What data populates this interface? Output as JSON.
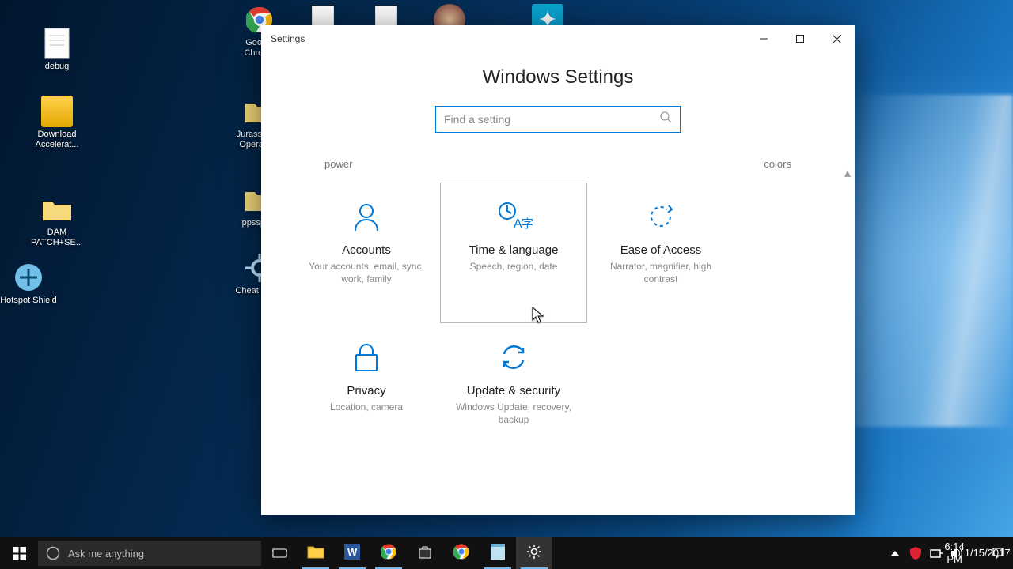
{
  "desktop_icons": {
    "debug": "debug",
    "download_accel": "Download Accelerat...",
    "dam_patch": "DAM PATCH+SE...",
    "hotspot": "Hotspot Shield",
    "chrome": "Google Chrome",
    "jurassic": "Jurassic P... Operatio...",
    "ppsspp": "ppsspp...",
    "cheat": "Cheat Eng..."
  },
  "window": {
    "title": "Settings",
    "heading": "Windows Settings",
    "search_placeholder": "Find a setting",
    "hints": {
      "left": "power",
      "right": "colors"
    },
    "tiles": {
      "accounts": {
        "title": "Accounts",
        "desc": "Your accounts, email, sync, work, family"
      },
      "time": {
        "title": "Time & language",
        "desc": "Speech, region, date"
      },
      "ease": {
        "title": "Ease of Access",
        "desc": "Narrator, magnifier, high contrast"
      },
      "privacy": {
        "title": "Privacy",
        "desc": "Location, camera"
      },
      "update": {
        "title": "Update & security",
        "desc": "Windows Update, recovery, backup"
      }
    }
  },
  "taskbar": {
    "cortana_placeholder": "Ask me anything",
    "time": "6:14 PM",
    "date": "1/15/2017"
  }
}
